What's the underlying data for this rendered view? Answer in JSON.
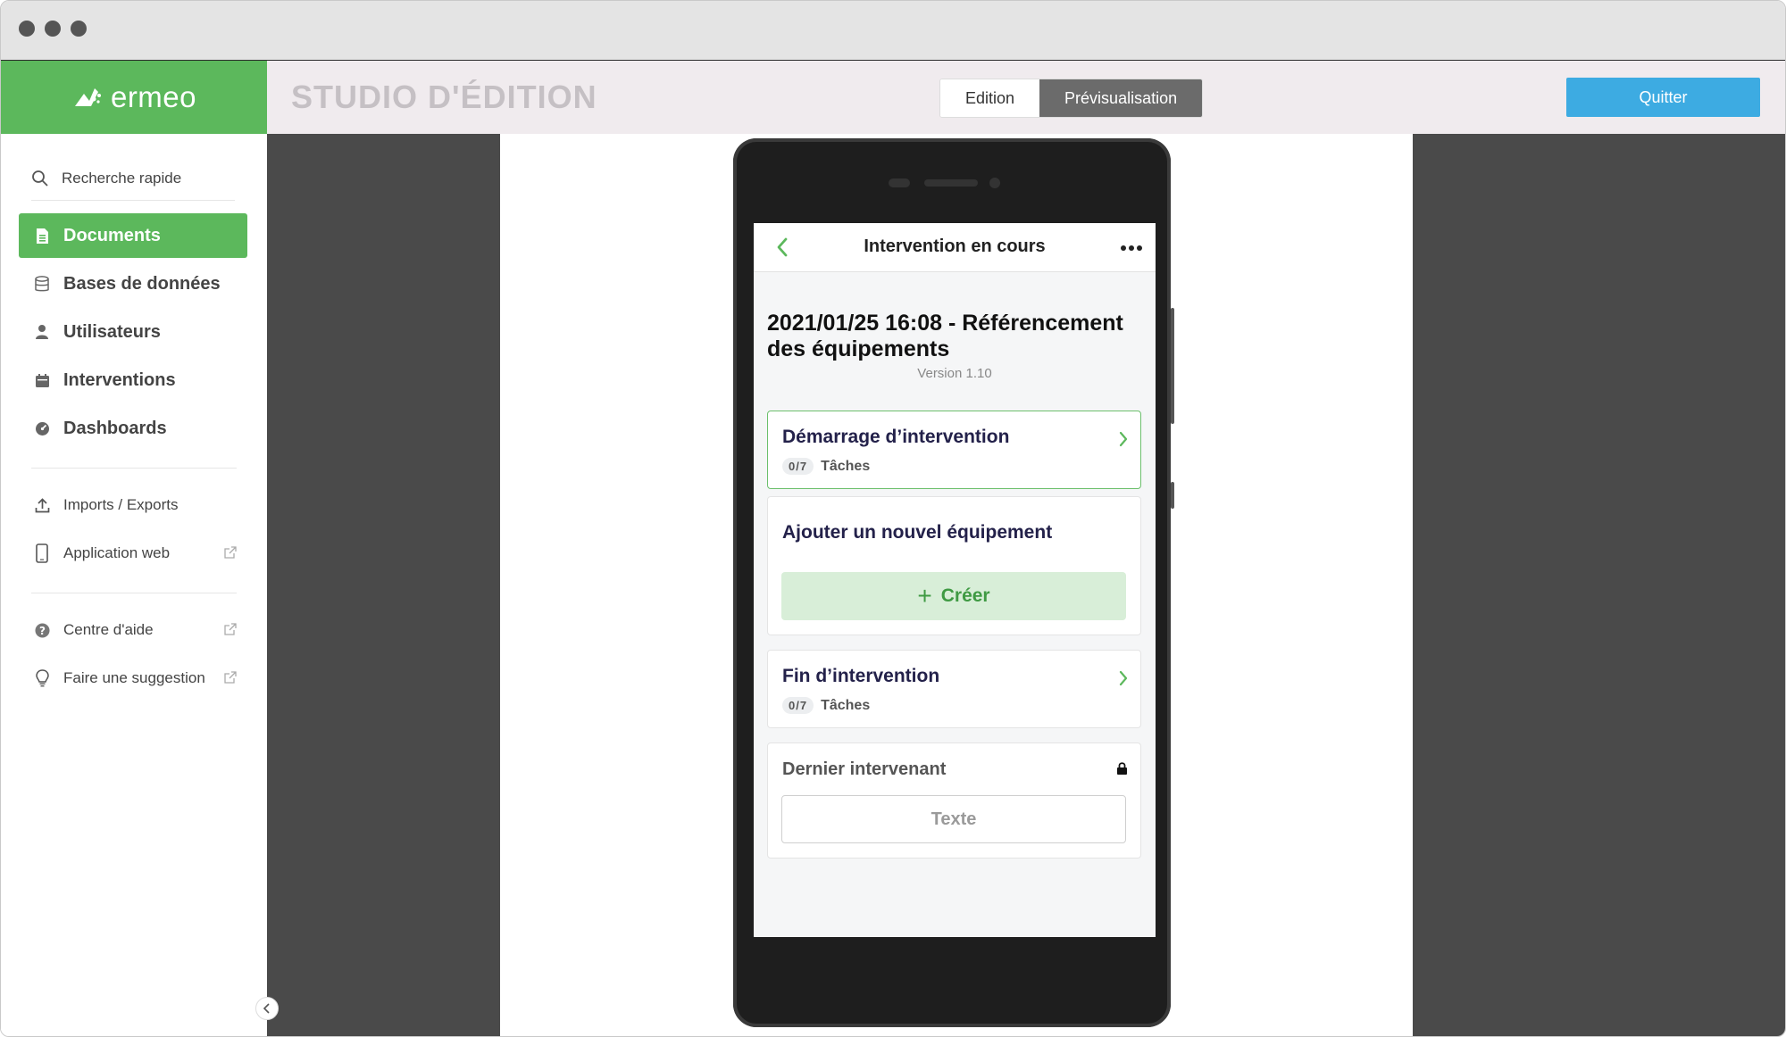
{
  "window": {
    "controls": [
      "window-dot",
      "window-dot",
      "window-dot"
    ]
  },
  "appbar": {
    "logo_text": "ermeo",
    "studio_title": "STUDIO D'ÉDITION",
    "toggle": {
      "edit_label": "Edition",
      "preview_label": "Prévisualisation",
      "active": "Prévisualisation"
    },
    "quit_label": "Quitter"
  },
  "sidebar": {
    "search_placeholder": "Recherche rapide",
    "nav": [
      {
        "label": "Documents",
        "icon": "document-icon",
        "active": true
      },
      {
        "label": "Bases de données",
        "icon": "database-icon",
        "active": false
      },
      {
        "label": "Utilisateurs",
        "icon": "user-icon",
        "active": false
      },
      {
        "label": "Interventions",
        "icon": "calendar-icon",
        "active": false
      },
      {
        "label": "Dashboards",
        "icon": "dashboard-icon",
        "active": false
      }
    ],
    "tools": [
      {
        "label": "Imports / Exports",
        "icon": "upload-icon"
      },
      {
        "label": "Application web",
        "icon": "mobile-icon",
        "external": true
      }
    ],
    "help": [
      {
        "label": "Centre d'aide",
        "icon": "help-icon",
        "external": true
      },
      {
        "label": "Faire une suggestion",
        "icon": "lightbulb-icon",
        "external": true
      }
    ]
  },
  "phone": {
    "header_title": "Intervention en cours",
    "doc_title": "2021/01/25 16:08 - Référencement des équipements",
    "doc_version": "Version 1.10",
    "cards": {
      "start": {
        "title": "Démarrage d’intervention",
        "count": "0/7",
        "tasks_label": "Tâches"
      },
      "add": {
        "title": "Ajouter un nouvel équipement",
        "button_label": "Créer"
      },
      "end": {
        "title": "Fin d’intervention",
        "count": "0/7",
        "tasks_label": "Tâches"
      },
      "last": {
        "title": "Dernier intervenant",
        "field_value": "Texte"
      }
    }
  },
  "colors": {
    "brand_green": "#5cb85c",
    "quit_blue": "#3dabe2",
    "canvas_gray": "#4a4a4a"
  }
}
